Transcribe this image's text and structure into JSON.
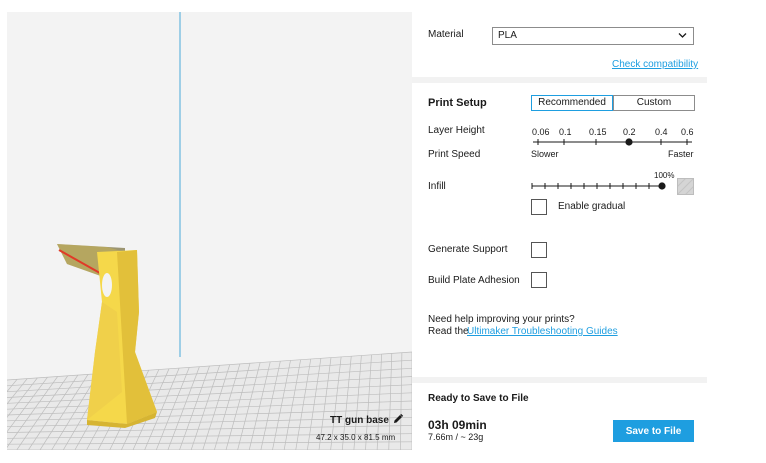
{
  "viewport": {
    "object_name": "TT gun base",
    "object_dims": "47.2 x 35.0 x 81.5 mm",
    "edit_icon": "pencil-icon"
  },
  "material": {
    "label": "Material",
    "selected": "PLA",
    "check_link": "Check compatibility"
  },
  "print_setup": {
    "title": "Print Setup",
    "modes": [
      "Recommended",
      "Custom"
    ],
    "active_mode": "Recommended",
    "layer_height": {
      "label": "Layer Height",
      "options": [
        "0.06",
        "0.1",
        "0.15",
        "0.2",
        "0.4",
        "0.6"
      ],
      "selected": "0.2"
    },
    "print_speed": {
      "label": "Print Speed",
      "slow": "Slower",
      "fast": "Faster"
    },
    "infill": {
      "label": "Infill",
      "value_label": "100%",
      "value": 100,
      "enable_gradual": "Enable gradual"
    },
    "generate_support": {
      "label": "Generate Support",
      "checked": false
    },
    "build_plate_adhesion": {
      "label": "Build Plate Adhesion",
      "checked": false
    },
    "help": {
      "line1": "Need help improving your prints?",
      "line2_prefix": "Read the",
      "link": "Ultimaker Troubleshooting Guides"
    }
  },
  "output": {
    "status": "Ready to Save to File",
    "time": "03h 09min",
    "usage": "7.66m / ~ 23g",
    "save_button": "Save to File"
  },
  "colors": {
    "accent": "#1e9ee0",
    "model": "#f5d84a",
    "grid": "#bdbdbd"
  }
}
